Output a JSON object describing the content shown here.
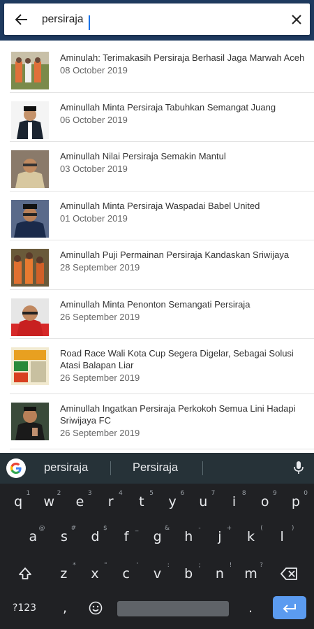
{
  "search": {
    "value": "persiraja",
    "back_icon": "arrow-left-icon",
    "clear_icon": "close-icon"
  },
  "colors": {
    "header_bg": "#1e3a5f",
    "keyboard_bg": "#202124",
    "accent": "#5b9bf0"
  },
  "results": [
    {
      "title": "Aminulah: Terimakasih Persiraja Berhasil Jaga Marwah Aceh",
      "date": "08 October 2019"
    },
    {
      "title": "Aminullah Minta Persiraja Tabuhkan Semangat Juang",
      "date": "06 October 2019"
    },
    {
      "title": "Aminullah Nilai Persiraja Semakin Mantul",
      "date": "03 October 2019"
    },
    {
      "title": "Aminullah Minta Persiraja Waspadai Babel United",
      "date": "01 October 2019"
    },
    {
      "title": "Aminullah Puji Permainan Persiraja Kandaskan Sriwijaya",
      "date": "28 September 2019"
    },
    {
      "title": "Aminullah Minta Penonton Semangati Persiraja",
      "date": "26 September 2019"
    },
    {
      "title": "Road Race Wali Kota Cup Segera Digelar, Sebagai Solusi Atasi Balapan Liar",
      "date": "26 September 2019"
    },
    {
      "title": "Aminullah Ingatkan Persiraja Perkokoh Semua Lini Hadapi Sriwijaya FC",
      "date": "26 September 2019"
    }
  ],
  "keyboard": {
    "suggestions": [
      "persiraja",
      "Persiraja"
    ],
    "row1": [
      [
        "q",
        "1"
      ],
      [
        "w",
        "2"
      ],
      [
        "e",
        "3"
      ],
      [
        "r",
        "4"
      ],
      [
        "t",
        "5"
      ],
      [
        "y",
        "6"
      ],
      [
        "u",
        "7"
      ],
      [
        "i",
        "8"
      ],
      [
        "o",
        "9"
      ],
      [
        "p",
        "0"
      ]
    ],
    "row2": [
      [
        "a",
        "@"
      ],
      [
        "s",
        "#"
      ],
      [
        "d",
        "$"
      ],
      [
        "f",
        "_"
      ],
      [
        "g",
        "&"
      ],
      [
        "h",
        "-"
      ],
      [
        "j",
        "+"
      ],
      [
        "k",
        "("
      ],
      [
        "l",
        ")"
      ]
    ],
    "row3": [
      [
        "z",
        "*"
      ],
      [
        "x",
        "\""
      ],
      [
        "c",
        "'"
      ],
      [
        "v",
        ":"
      ],
      [
        "b",
        ";"
      ],
      [
        "n",
        "!"
      ],
      [
        "m",
        "?"
      ]
    ],
    "symbols_label": "?123",
    "comma": ",",
    "period": "."
  }
}
